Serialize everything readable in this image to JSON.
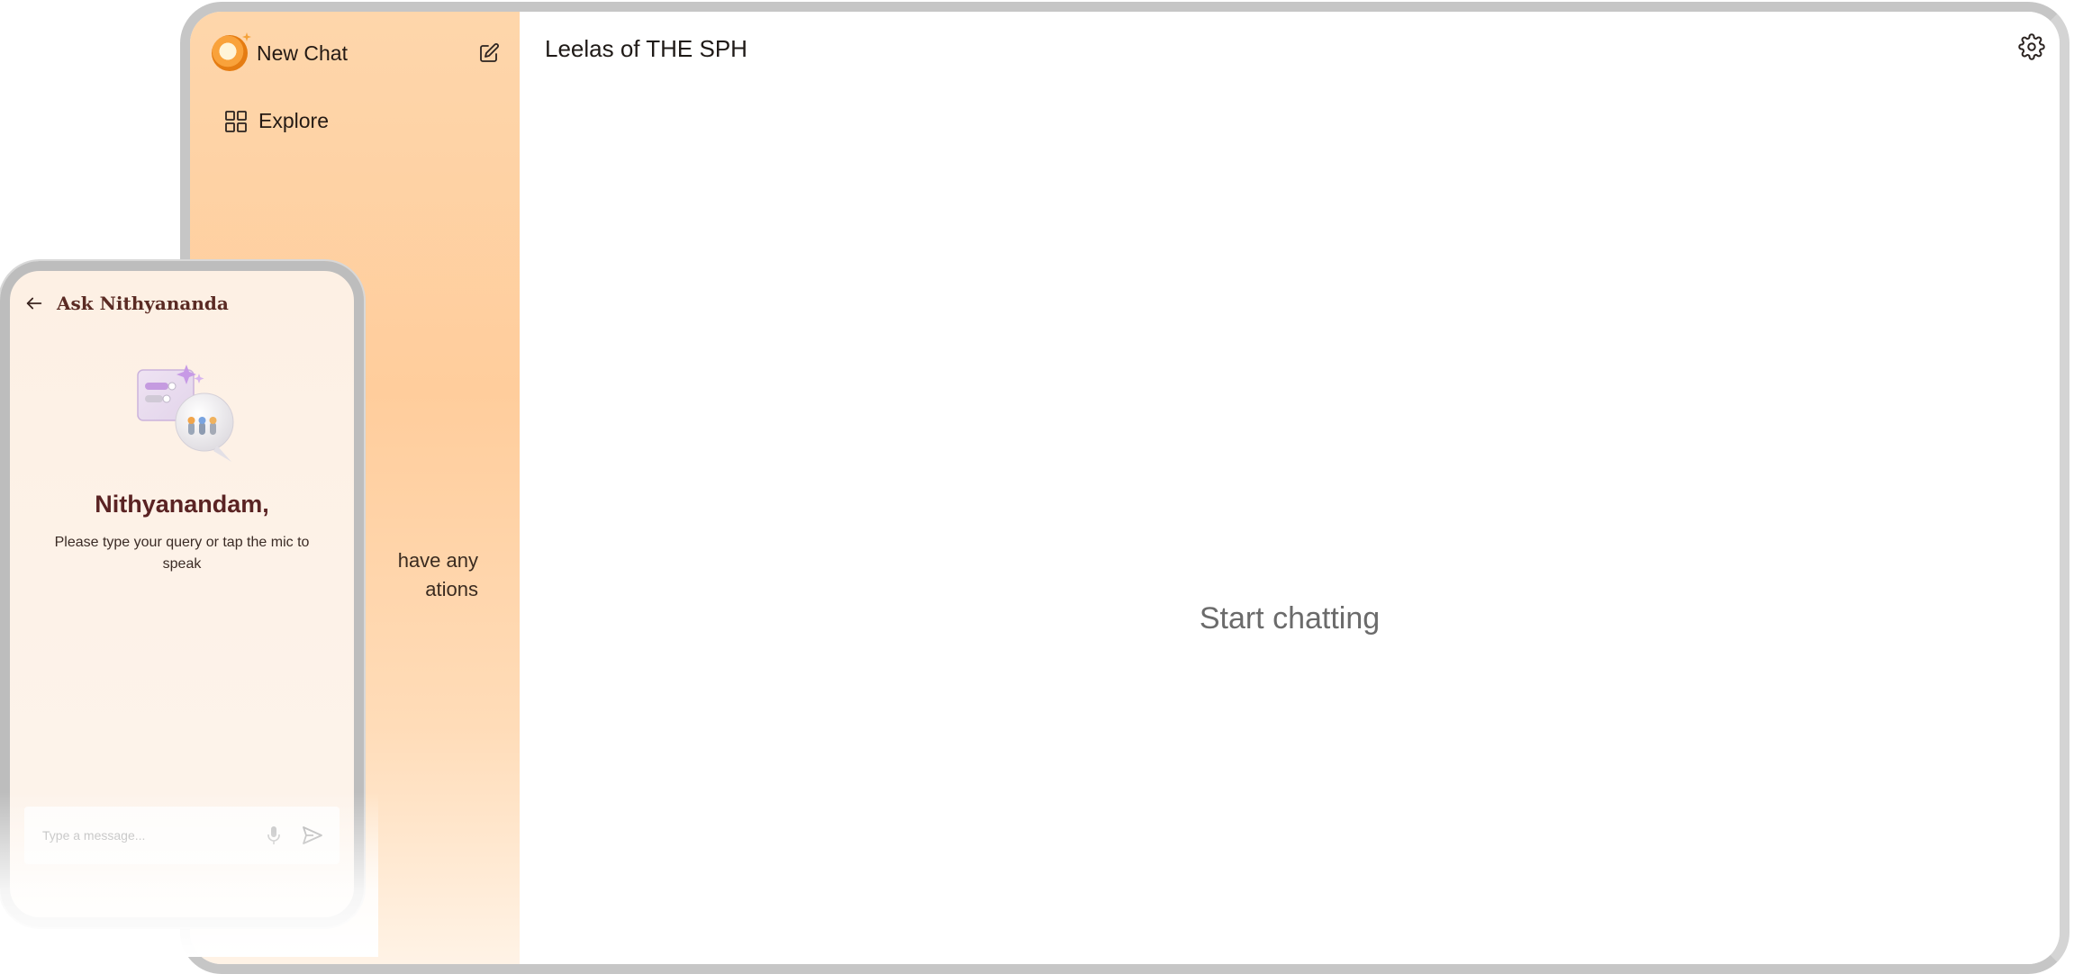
{
  "desktop": {
    "sidebar": {
      "new_chat_label": "New Chat",
      "edit_icon": "edit-icon",
      "explore_label": "Explore",
      "explore_icon": "grid-icon",
      "empty_text_visible": "have any\nations"
    },
    "main": {
      "title": "Leelas of THE SPH",
      "settings_icon": "gear-icon",
      "empty_state": "Start chatting"
    }
  },
  "phone": {
    "header": {
      "back_icon": "arrow-left-icon",
      "title": "Ask Nithyananda"
    },
    "greeting": "Nithyanandam,",
    "subtext": "Please type your query or tap the mic to speak",
    "input": {
      "placeholder": "Type a message...",
      "value": ""
    },
    "mic_icon": "mic-icon",
    "send_icon": "send-icon"
  },
  "colors": {
    "sidebar_accent": "#ffcd9c",
    "greeting_color": "#5a2323",
    "phone_title_color": "#5a2a23",
    "muted_text": "#6b6b6b"
  }
}
